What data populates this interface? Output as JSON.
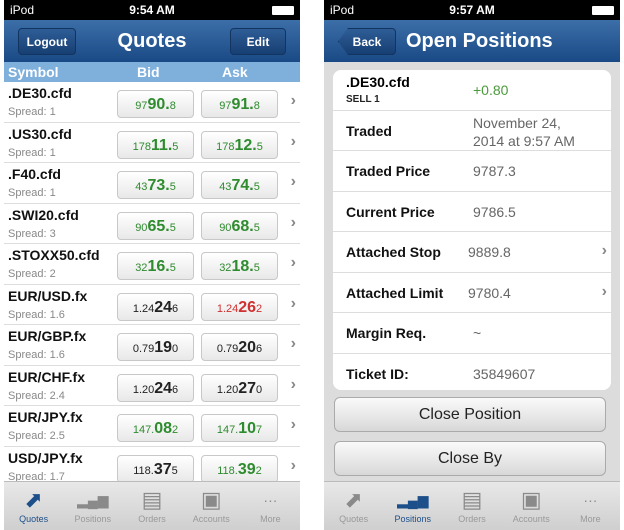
{
  "colors": {
    "nav": "#1a4a85",
    "header": "#7fb0dc",
    "up": "#2e8b2e",
    "down": "#d03030",
    "neutral": "#222222"
  },
  "left": {
    "status": {
      "carrier": "iPod",
      "time": "9:54 AM"
    },
    "nav": {
      "left": "Logout",
      "title": "Quotes",
      "right": "Edit"
    },
    "columns": [
      "Symbol",
      "Bid",
      "Ask"
    ],
    "quotes": [
      {
        "symbol": ".DE30.cfd",
        "spread": "Spread: 1",
        "bid": {
          "pre": "97",
          "big": "90.",
          "sub": "8",
          "color": "up"
        },
        "ask": {
          "pre": "97",
          "big": "91.",
          "sub": "8",
          "color": "up"
        }
      },
      {
        "symbol": ".US30.cfd",
        "spread": "Spread: 1",
        "bid": {
          "pre": "178",
          "big": "11.",
          "sub": "5",
          "color": "up"
        },
        "ask": {
          "pre": "178",
          "big": "12.",
          "sub": "5",
          "color": "up"
        }
      },
      {
        "symbol": ".F40.cfd",
        "spread": "Spread: 1",
        "bid": {
          "pre": "43",
          "big": "73.",
          "sub": "5",
          "color": "up"
        },
        "ask": {
          "pre": "43",
          "big": "74.",
          "sub": "5",
          "color": "up"
        }
      },
      {
        "symbol": ".SWI20.cfd",
        "spread": "Spread: 3",
        "bid": {
          "pre": "90",
          "big": "65.",
          "sub": "5",
          "color": "up"
        },
        "ask": {
          "pre": "90",
          "big": "68.",
          "sub": "5",
          "color": "up"
        }
      },
      {
        "symbol": ".STOXX50.cfd",
        "spread": "Spread: 2",
        "bid": {
          "pre": "32",
          "big": "16.",
          "sub": "5",
          "color": "up"
        },
        "ask": {
          "pre": "32",
          "big": "18.",
          "sub": "5",
          "color": "up"
        }
      },
      {
        "symbol": "EUR/USD.fx",
        "spread": "Spread: 1.6",
        "bid": {
          "pre": "1.24",
          "big": "24",
          "sub": "6",
          "color": "neutral"
        },
        "ask": {
          "pre": "1.24",
          "big": "26",
          "sub": "2",
          "color": "down"
        }
      },
      {
        "symbol": "EUR/GBP.fx",
        "spread": "Spread: 1.6",
        "bid": {
          "pre": "0.79",
          "big": "19",
          "sub": "0",
          "color": "neutral"
        },
        "ask": {
          "pre": "0.79",
          "big": "20",
          "sub": "6",
          "color": "neutral"
        }
      },
      {
        "symbol": "EUR/CHF.fx",
        "spread": "Spread: 2.4",
        "bid": {
          "pre": "1.20",
          "big": "24",
          "sub": "6",
          "color": "neutral"
        },
        "ask": {
          "pre": "1.20",
          "big": "27",
          "sub": "0",
          "color": "neutral"
        }
      },
      {
        "symbol": "EUR/JPY.fx",
        "spread": "Spread: 2.5",
        "bid": {
          "pre": "147.",
          "big": "08",
          "sub": "2",
          "color": "up"
        },
        "ask": {
          "pre": "147.",
          "big": "10",
          "sub": "7",
          "color": "up"
        }
      },
      {
        "symbol": "USD/JPY.fx",
        "spread": "Spread: 1.7",
        "bid": {
          "pre": "118.",
          "big": "37",
          "sub": "5",
          "color": "neutral"
        },
        "ask": {
          "pre": "118.",
          "big": "39",
          "sub": "2",
          "color": "up"
        }
      }
    ],
    "active_tab": 0
  },
  "right": {
    "status": {
      "carrier": "iPod",
      "time": "9:57 AM"
    },
    "nav": {
      "left": "Back",
      "title": "Open Positions"
    },
    "position": {
      "symbol": ".DE30.cfd",
      "side": "SELL 1",
      "pl": "+0.80"
    },
    "details": [
      {
        "label": "Traded",
        "value": "November 24, 2014 at 9:57 AM"
      },
      {
        "label": "Traded Price",
        "value": "9787.3"
      },
      {
        "label": "Current Price",
        "value": "9786.5"
      },
      {
        "label": "Attached Stop",
        "value": "9889.8",
        "chevron": true
      },
      {
        "label": "Attached Limit",
        "value": "9780.4",
        "chevron": true
      },
      {
        "label": "Margin Req.",
        "value": "~"
      },
      {
        "label": "Ticket ID:",
        "value": "35849607"
      }
    ],
    "buttons": [
      "Close Position",
      "Close By"
    ],
    "active_tab": 1
  },
  "tabs": [
    {
      "label": "Quotes",
      "icon": "quotes-arrows-icon"
    },
    {
      "label": "Positions",
      "icon": "bar-chart-icon"
    },
    {
      "label": "Orders",
      "icon": "document-icon"
    },
    {
      "label": "Accounts",
      "icon": "id-badge-icon"
    },
    {
      "label": "More",
      "icon": "more-dots-icon"
    }
  ]
}
